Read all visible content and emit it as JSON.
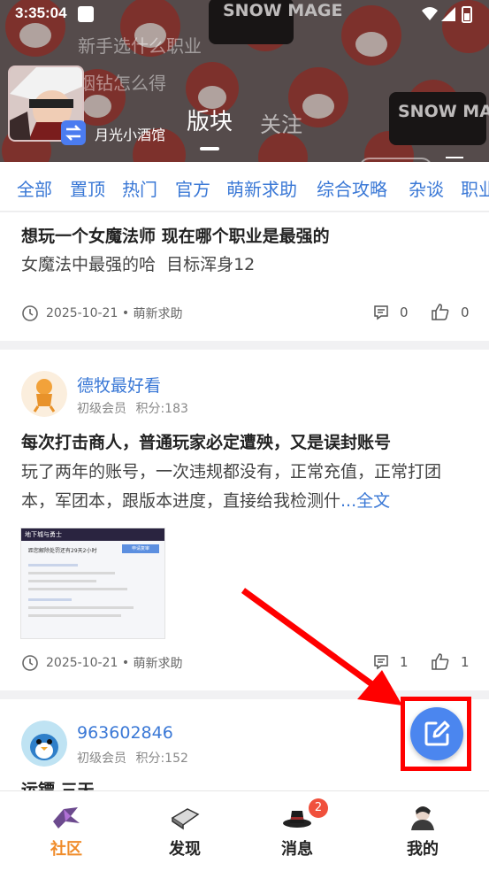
{
  "status_bar": {
    "time": "3:35:04"
  },
  "header": {
    "banner_text": "SNOW MAGE",
    "hint_lines": [
      "新手选什么职业",
      "烟钻怎么得"
    ],
    "server_name": "月光小酒馆",
    "tabs": [
      {
        "label": "版块",
        "active": true
      },
      {
        "label": "关注",
        "active": false
      }
    ]
  },
  "categories": [
    "全部",
    "置顶",
    "热门",
    "官方",
    "萌新求助",
    "综合攻略",
    "杂谈",
    "职业"
  ],
  "posts": [
    {
      "title": "想玩一个女魔法师 现在哪个职业是最强的",
      "body": "女魔法中最强的哈  目标浑身12",
      "date": "2025-10-21",
      "tag": "萌新求助",
      "comments": "0",
      "likes": "0"
    },
    {
      "author": "德牧最好看",
      "level": "初级会员",
      "points": "积分:183",
      "title": "每次打击商人，普通玩家必定遭殃，又是误封账号",
      "body": "玩了两年的账号，一次违规都没有，正常充值，正常打团本，军团本，跟版本进度，直接给我检测什",
      "more": "...全文",
      "thumbnail": {
        "heading": "地下城与勇士",
        "line1": "距您解除处罚还有29天2小时",
        "button": "申请复审"
      },
      "date": "2025-10-21",
      "tag": "萌新求助",
      "comments": "1",
      "likes": "1"
    },
    {
      "author": "963602846",
      "level": "初级会员",
      "points": "积分:152",
      "title": "运镖 三天"
    }
  ],
  "bottom_nav": [
    {
      "label": "社区",
      "active": true
    },
    {
      "label": "发现",
      "active": false
    },
    {
      "label": "消息",
      "active": false,
      "badge": "2"
    },
    {
      "label": "我的",
      "active": false
    }
  ],
  "colors": {
    "accent": "#3a78d6",
    "nav_active": "#f08c2a",
    "fab": "#4b86ef",
    "annotation": "#ff0000"
  }
}
